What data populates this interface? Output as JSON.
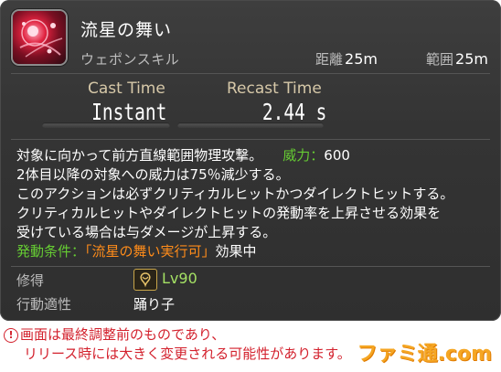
{
  "skill": {
    "name": "流星の舞い",
    "type": "ウェポンスキル",
    "distance_label": "距離",
    "distance_value": "25m",
    "range_label": "範囲",
    "range_value": "25m"
  },
  "timing": {
    "cast_label": "Cast Time",
    "cast_value": "Instant",
    "recast_label": "Recast Time",
    "recast_value": "2.44 s"
  },
  "description": {
    "line1": "対象に向かって前方直線範囲物理攻撃。",
    "potency_label": "威力：",
    "potency_value": "600",
    "line2": "2体目以降の対象への威力は75％減少する。",
    "line3": "このアクションは必ずクリティカルヒットかつダイレクトヒットする。",
    "line4": "クリティカルヒットやダイレクトヒットの発動率を上昇させる効果を",
    "line5": "受けている場合は与ダメージが上昇する。",
    "condition_label": "発動条件：",
    "condition_effect": "「流星の舞い実行可」",
    "condition_suffix": "効果中"
  },
  "meta": {
    "acquired_label": "修得",
    "level": "Lv90",
    "job_label": "行動適性",
    "job_value": "踊り子"
  },
  "warning": {
    "mark": "!",
    "line1": "画面は最終調整前のものであり、",
    "line2": "リリース時には大きく変更される可能性があります。"
  },
  "watermark": "ファミ通.com",
  "icons": {
    "skill": "starfall-dance-icon",
    "job": "dancer-job-icon"
  },
  "colors": {
    "potency": "#66cc33",
    "condition": "#ff8c1a",
    "warning": "#d3212d",
    "level": "#a4e064"
  }
}
